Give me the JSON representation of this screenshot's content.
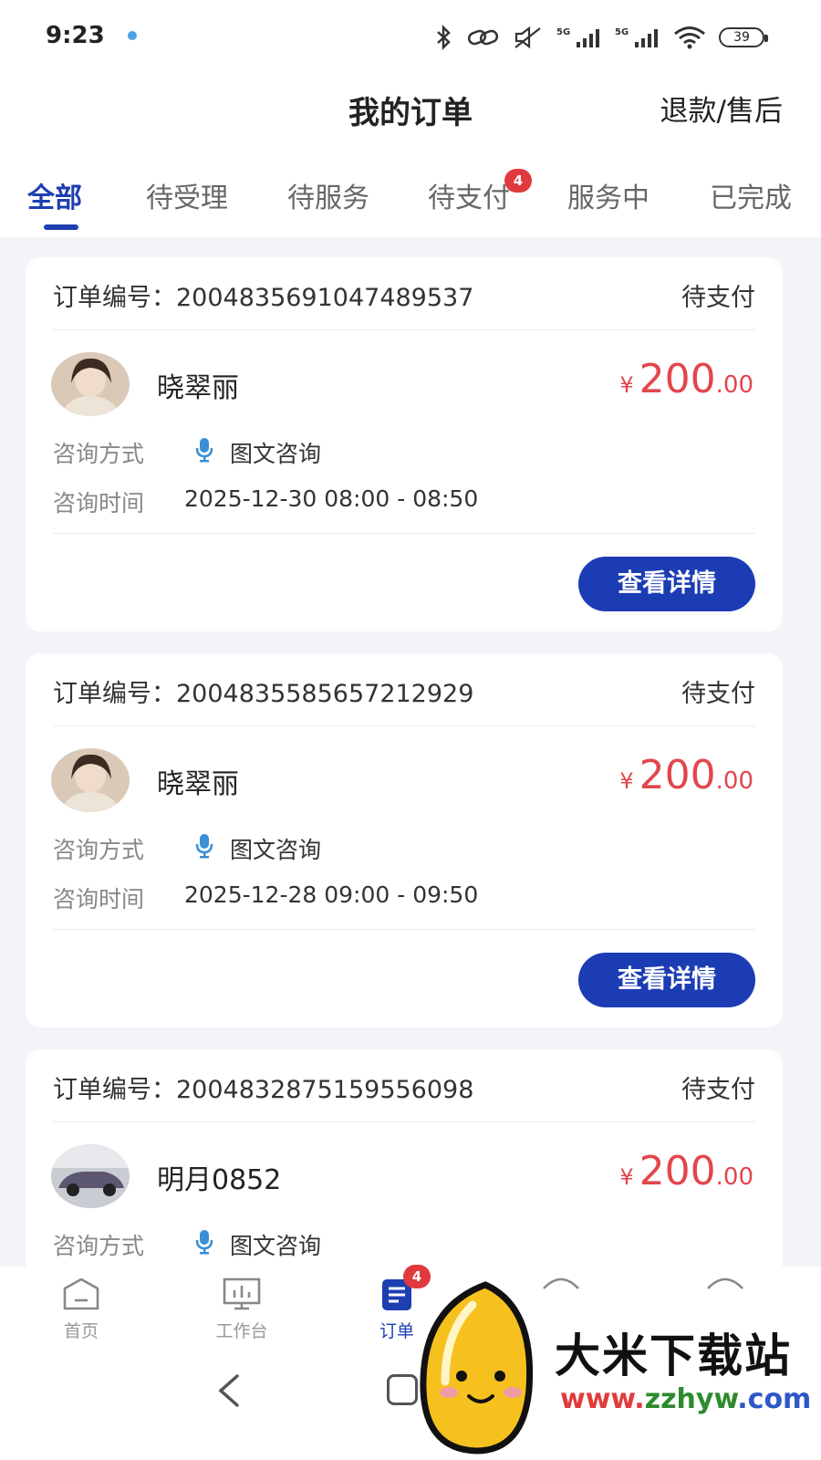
{
  "status_bar": {
    "time": "9:23",
    "battery": "39"
  },
  "header": {
    "title": "我的订单",
    "refund_link": "退款/售后"
  },
  "tabs": [
    {
      "label": "全部",
      "active": true
    },
    {
      "label": "待受理"
    },
    {
      "label": "待服务"
    },
    {
      "label": "待支付",
      "badge": "4"
    },
    {
      "label": "服务中"
    },
    {
      "label": "已完成"
    }
  ],
  "orders": [
    {
      "order_no": "订单编号：2004835691047489537",
      "status": "待支付",
      "user": "晓翠丽",
      "price": {
        "currency": "¥",
        "integer": "200",
        "decimal": ".00"
      },
      "method_label": "咨询方式",
      "method_value": "图文咨询",
      "time_label": "咨询时间",
      "time_value": "2025-12-30 08:00 - 08:50",
      "detail_button": "查看详情"
    },
    {
      "order_no": "订单编号：2004835585657212929",
      "status": "待支付",
      "user": "晓翠丽",
      "price": {
        "currency": "¥",
        "integer": "200",
        "decimal": ".00"
      },
      "method_label": "咨询方式",
      "method_value": "图文咨询",
      "time_label": "咨询时间",
      "time_value": "2025-12-28 09:00 - 09:50",
      "detail_button": "查看详情"
    },
    {
      "order_no": "订单编号：2004832875159556098",
      "status": "待支付",
      "user": "明月0852",
      "price": {
        "currency": "¥",
        "integer": "200",
        "decimal": ".00"
      },
      "method_label": "咨询方式",
      "method_value": "图文咨询"
    }
  ],
  "tabbar": [
    {
      "label": "首页",
      "icon": "home-icon"
    },
    {
      "label": "工作台",
      "icon": "workbench-icon"
    },
    {
      "label": "订单",
      "icon": "order-icon",
      "active": true,
      "badge": "4"
    }
  ],
  "watermark": {
    "name": "大米下载站",
    "url": "www.zzhyw.com"
  },
  "colors": {
    "accent": "#1d3fb0",
    "price": "#e0474c",
    "badge": "#e03a3e",
    "button": "#1c3cb4"
  }
}
